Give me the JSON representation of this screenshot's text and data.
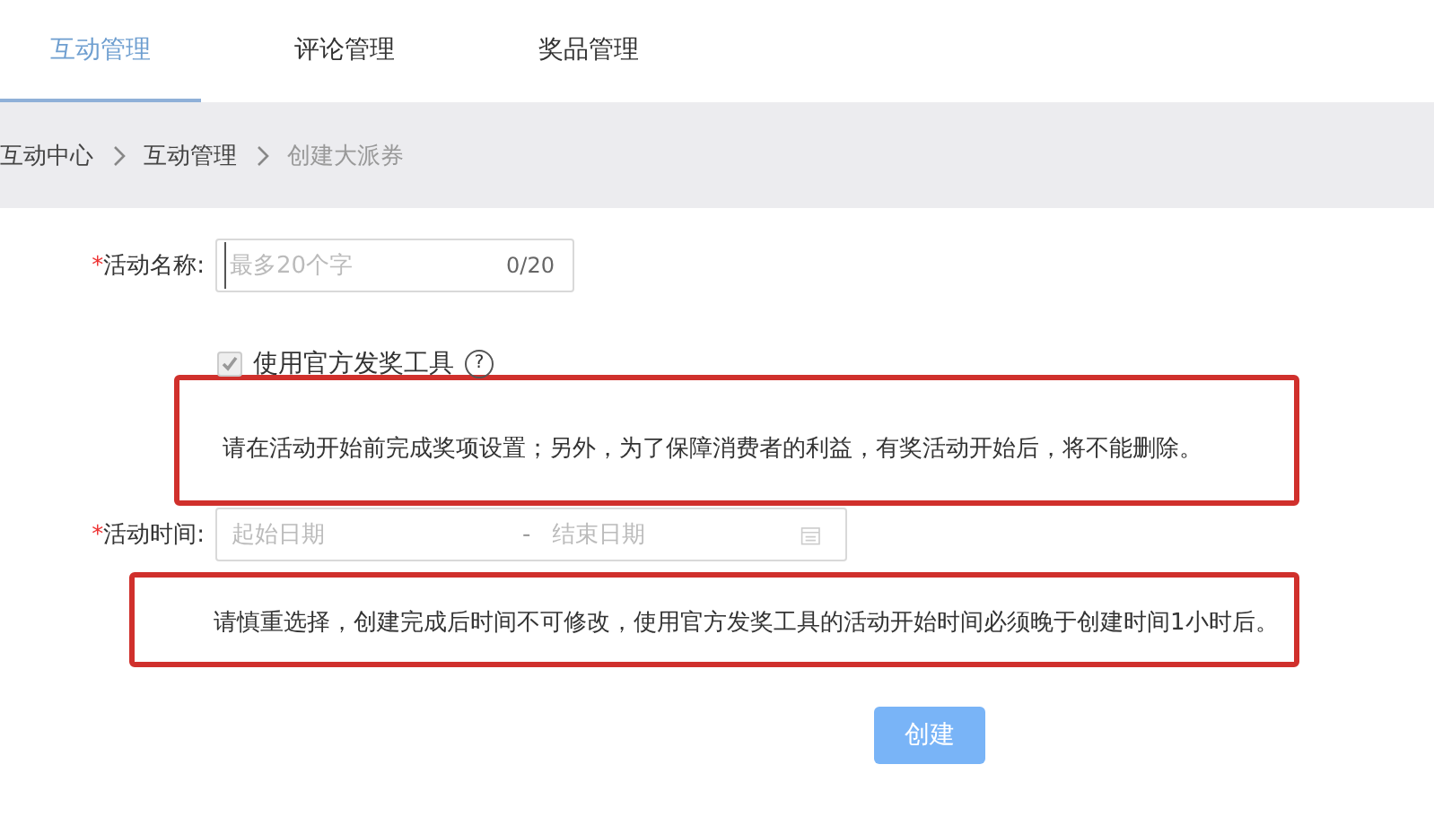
{
  "tabs": [
    {
      "label": "互动管理",
      "selected": true
    },
    {
      "label": "评论管理",
      "selected": false
    },
    {
      "label": "奖品管理",
      "selected": false
    }
  ],
  "breadcrumb": [
    {
      "label": "互动中心",
      "current": false
    },
    {
      "label": "互动管理",
      "current": false
    },
    {
      "label": "创建大派券",
      "current": true
    }
  ],
  "form": {
    "name_field": {
      "required_mark": "*",
      "label": "活动名称:",
      "placeholder": "最多20个字",
      "counter": "0/20"
    },
    "official_tool": {
      "label": "使用官方发奖工具",
      "checked": true,
      "disabled": true,
      "help_mark": "?"
    },
    "note_1": "请在活动开始前完成奖项设置；另外，为了保障消费者的利益，有奖活动开始后，将不能删除。",
    "time_field": {
      "required_mark": "*",
      "label": "活动时间:",
      "start_placeholder": "起始日期",
      "separator": "-",
      "end_placeholder": "结束日期"
    },
    "note_2": "请慎重选择，创建完成后时间不可修改，使用官方发奖工具的活动开始时间必须晚于创建时间1小时后。",
    "submit": {
      "label": "创建",
      "disabled": true
    }
  }
}
